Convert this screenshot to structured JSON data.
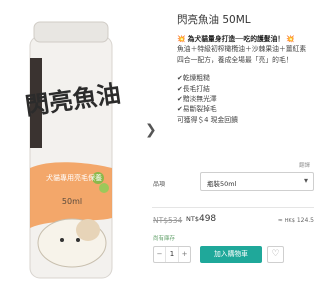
{
  "product": {
    "title": "閃亮魚油 50ML",
    "image": {
      "brand_title": "閃亮魚油",
      "subtitle": "犬貓專用亮毛保養",
      "volume": "50ml"
    },
    "description": {
      "spark": "💥",
      "headline": "為犬貓量身打造──吃的護髮油！",
      "ingredients": "魚油＋特級初榨橄欖油＋沙棘果油＋薑紅素",
      "formula": "四合一配方，養成全場最「亮」的毛！",
      "benefits": [
        "✔乾燥粗糙",
        "✔長毛打結",
        "✔黯淡無光澤",
        "✔易斷裂掉毛",
        "可獲得＄4 現金回饋"
      ]
    },
    "translate_label": "翻譯",
    "option": {
      "label": "品項",
      "selected": "瓶裝50ml",
      "chevron": "▾"
    },
    "price": {
      "old": "NT$534",
      "currency": "NT$",
      "new_amount": "498",
      "alt_prefix": "≈",
      "alt_currency": "HK$",
      "alt_amount": "124.5"
    },
    "stock": "尚有庫存",
    "quantity": {
      "minus": "−",
      "value": "1",
      "plus": "+"
    },
    "add_to_cart": "加入購物車",
    "wishlist_icon": "heart-icon",
    "wishlist_glyph": "♡",
    "next_glyph": "❯"
  },
  "colors": {
    "accent": "#1fa89a",
    "can_body": "#f3f1ee",
    "can_orange": "#f29a52",
    "in_stock": "#62a06a"
  }
}
